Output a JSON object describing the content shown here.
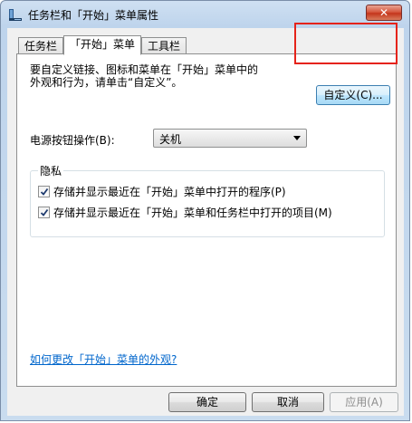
{
  "window": {
    "title": "任务栏和「开始」菜单属性",
    "close_glyph": "✕"
  },
  "tabs": [
    {
      "label": "任务栏",
      "active": false
    },
    {
      "label": "「开始」菜单",
      "active": true
    },
    {
      "label": "工具栏",
      "active": false
    }
  ],
  "start_menu": {
    "intro_line1": "要自定义链接、图标和菜单在「开始」菜单中的",
    "intro_line2": "外观和行为，请单击“自定义”。",
    "customize_label": "自定义(C)...",
    "power_label": "电源按钮操作(B):",
    "power_value": "关机",
    "privacy_title": "隐私",
    "privacy_checkbox1": "存储并显示最近在「开始」菜单中打开的程序(P)",
    "privacy_checkbox1_checked": true,
    "privacy_checkbox2": "存储并显示最近在「开始」菜单和任务栏中打开的项目(M)",
    "privacy_checkbox2_checked": true,
    "help_link": "如何更改「开始」菜单的外观?"
  },
  "buttons": {
    "ok": "确定",
    "cancel": "取消",
    "apply": "应用(A)"
  },
  "colors": {
    "highlight": "#e5231a",
    "link": "#0066cc"
  }
}
